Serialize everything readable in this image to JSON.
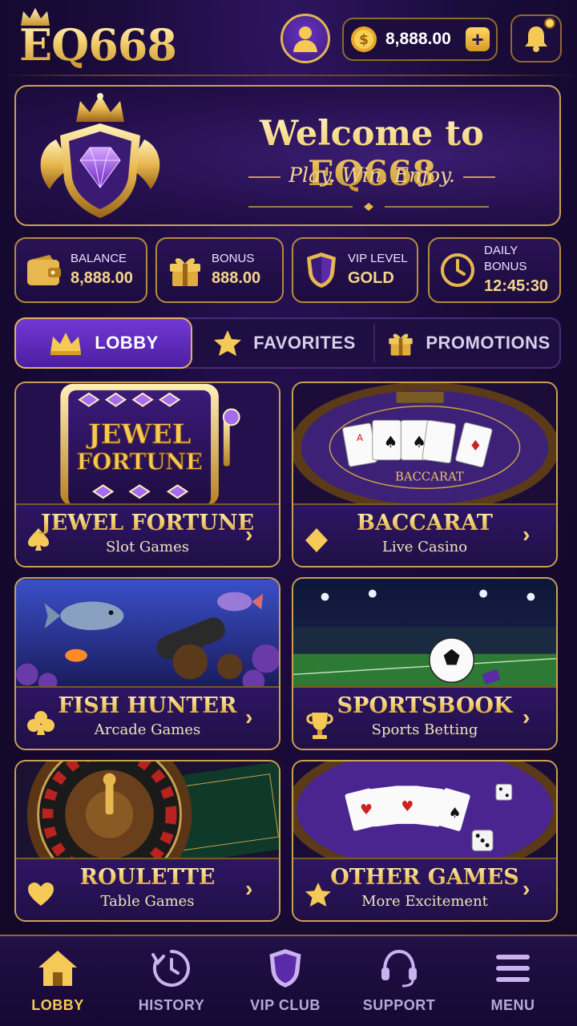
{
  "header": {
    "logo_text": "EQ668",
    "wallet_amount": "8,888.00",
    "wallet_add": "+"
  },
  "banner": {
    "title": "Welcome to EQ668",
    "subtitle": "Play. Win. Enjoy."
  },
  "stats": [
    {
      "label": "BALANCE",
      "value": "8,888.00",
      "icon": "wallet-icon"
    },
    {
      "label": "BONUS",
      "value": "888.00",
      "icon": "gift-icon"
    },
    {
      "label": "VIP LEVEL",
      "value": "GOLD",
      "icon": "shield-icon"
    },
    {
      "label": "DAILY BONUS",
      "value": "12:45:30",
      "icon": "clock-icon"
    }
  ],
  "tabs": [
    {
      "label": "LOBBY",
      "icon": "crown-icon",
      "active": true
    },
    {
      "label": "FAVORITES",
      "icon": "star-icon",
      "active": false
    },
    {
      "label": "PROMOTIONS",
      "icon": "gift-icon",
      "active": false
    }
  ],
  "games": [
    {
      "title": "JEWEL FORTUNE",
      "subtitle": "Slot Games",
      "art_text": [
        "JEWEL",
        "FORTUNE"
      ],
      "suit": "spade-icon"
    },
    {
      "title": "BACCARAT",
      "subtitle": "Live Casino",
      "art_text": "BACCARAT",
      "suit": "diamond-icon"
    },
    {
      "title": "FISH HUNTER",
      "subtitle": "Arcade Games",
      "suit": "club-icon"
    },
    {
      "title": "SPORTSBOOK",
      "subtitle": "Sports Betting",
      "suit": "trophy-icon"
    },
    {
      "title": "ROULETTE",
      "subtitle": "Table Games",
      "suit": "heart-icon"
    },
    {
      "title": "OTHER GAMES",
      "subtitle": "More Excitement",
      "suit": "star-icon"
    }
  ],
  "chevron": "›",
  "bottom_nav": [
    {
      "label": "LOBBY",
      "icon": "home-icon",
      "active": true
    },
    {
      "label": "HISTORY",
      "icon": "history-icon",
      "active": false
    },
    {
      "label": "VIP CLUB",
      "icon": "shield-icon",
      "active": false
    },
    {
      "label": "SUPPORT",
      "icon": "headset-icon",
      "active": false
    },
    {
      "label": "MENU",
      "icon": "menu-icon",
      "active": false
    }
  ],
  "colors": {
    "background": "#1a0b3a",
    "gold": "#f2cf6e",
    "purple_accent": "#6a34c6"
  }
}
